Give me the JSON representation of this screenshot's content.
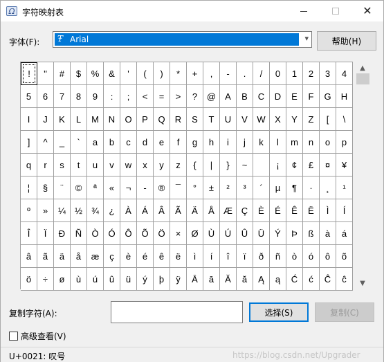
{
  "window": {
    "title": "字符映射表",
    "close_glyph": "✕"
  },
  "font": {
    "label": "字体(F):",
    "selected": "Arial",
    "type_icon": "truetype-font-icon"
  },
  "buttons": {
    "help": "帮助(H)",
    "select": "选择(S)",
    "copy": "复制(C)"
  },
  "copy": {
    "label": "复制字符(A):",
    "value": ""
  },
  "advanced": {
    "label": "高级查看(V)",
    "checked": false
  },
  "status": {
    "text": "U+0021: 叹号",
    "watermark": "https://blog.csdn.net/Upgrader"
  },
  "characters": [
    [
      "!",
      "\"",
      "#",
      "$",
      "%",
      "&",
      "'",
      "(",
      ")",
      "*",
      "+",
      ",",
      "-",
      ".",
      "/",
      "0",
      "1",
      "2",
      "3",
      "4"
    ],
    [
      "5",
      "6",
      "7",
      "8",
      "9",
      ":",
      ";",
      "<",
      "=",
      ">",
      "?",
      "@",
      "A",
      "B",
      "C",
      "D",
      "E",
      "F",
      "G",
      "H"
    ],
    [
      "I",
      "J",
      "K",
      "L",
      "M",
      "N",
      "O",
      "P",
      "Q",
      "R",
      "S",
      "T",
      "U",
      "V",
      "W",
      "X",
      "Y",
      "Z",
      "[",
      "\\"
    ],
    [
      "]",
      "^",
      "_",
      "`",
      "a",
      "b",
      "c",
      "d",
      "e",
      "f",
      "g",
      "h",
      "i",
      "j",
      "k",
      "l",
      "m",
      "n",
      "o",
      "p"
    ],
    [
      "q",
      "r",
      "s",
      "t",
      "u",
      "v",
      "w",
      "x",
      "y",
      "z",
      "{",
      "|",
      "}",
      "~",
      " ",
      "¡",
      "¢",
      "£",
      "¤",
      "¥"
    ],
    [
      "¦",
      "§",
      "¨",
      "©",
      "ª",
      "«",
      "¬",
      "-",
      "®",
      "¯",
      "°",
      "±",
      "²",
      "³",
      "´",
      "µ",
      "¶",
      "·",
      "¸",
      "¹"
    ],
    [
      "º",
      "»",
      "¼",
      "½",
      "¾",
      "¿",
      "À",
      "Á",
      "Â",
      "Ã",
      "Ä",
      "Å",
      "Æ",
      "Ç",
      "È",
      "É",
      "Ê",
      "Ë",
      "Ì",
      "Í"
    ],
    [
      "Î",
      "Ï",
      "Ð",
      "Ñ",
      "Ò",
      "Ó",
      "Ô",
      "Õ",
      "Ö",
      "×",
      "Ø",
      "Ù",
      "Ú",
      "Û",
      "Ü",
      "Ý",
      "Þ",
      "ß",
      "à",
      "á"
    ],
    [
      "â",
      "ã",
      "ä",
      "å",
      "æ",
      "ç",
      "è",
      "é",
      "ê",
      "ë",
      "ì",
      "í",
      "î",
      "ï",
      "ð",
      "ñ",
      "ò",
      "ó",
      "ô",
      "õ"
    ],
    [
      "ö",
      "÷",
      "ø",
      "ù",
      "ú",
      "û",
      "ü",
      "ý",
      "þ",
      "ÿ",
      "Ā",
      "ā",
      "Ă",
      "ă",
      "Ą",
      "ą",
      "Ć",
      "ć",
      "Ĉ",
      "ĉ"
    ]
  ],
  "selected_character": "!"
}
